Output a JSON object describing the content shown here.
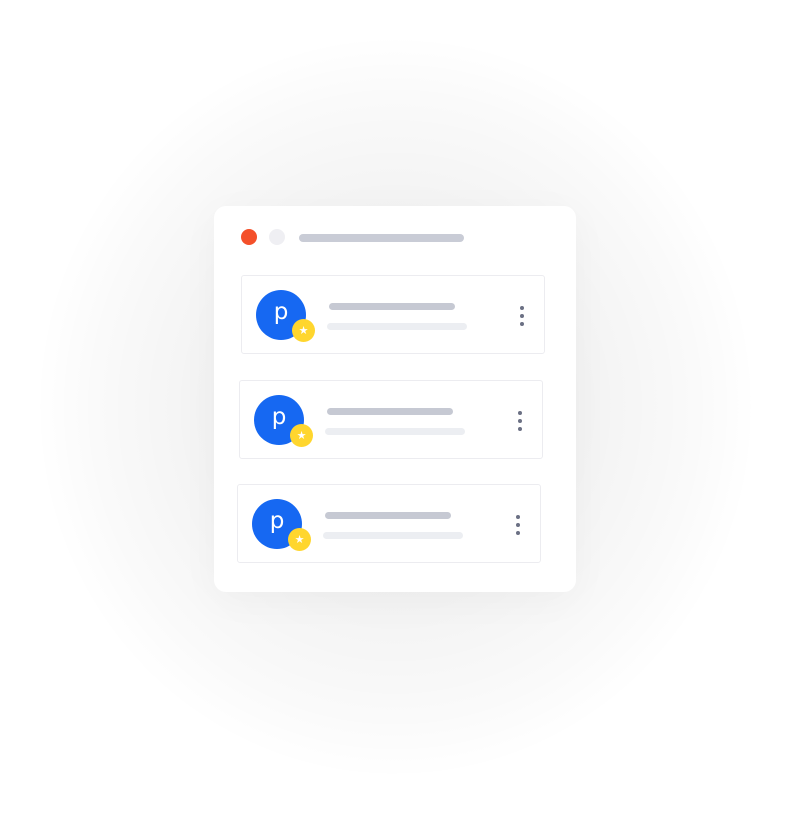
{
  "window": {
    "colors": {
      "close_dot": "#f4502a",
      "minimize_dot": "#efeff3"
    }
  },
  "cards": [
    {
      "avatar_letter": "p",
      "badge_icon": "star-icon",
      "badge_glyph": "★",
      "menu_icon": "more-vertical-icon"
    },
    {
      "avatar_letter": "p",
      "badge_icon": "star-icon",
      "badge_glyph": "★",
      "menu_icon": "more-vertical-icon"
    },
    {
      "avatar_letter": "p",
      "badge_icon": "star-icon",
      "badge_glyph": "★",
      "menu_icon": "more-vertical-icon"
    }
  ],
  "accent_colors": {
    "avatar": "#1668f2",
    "badge": "#ffd62e"
  }
}
